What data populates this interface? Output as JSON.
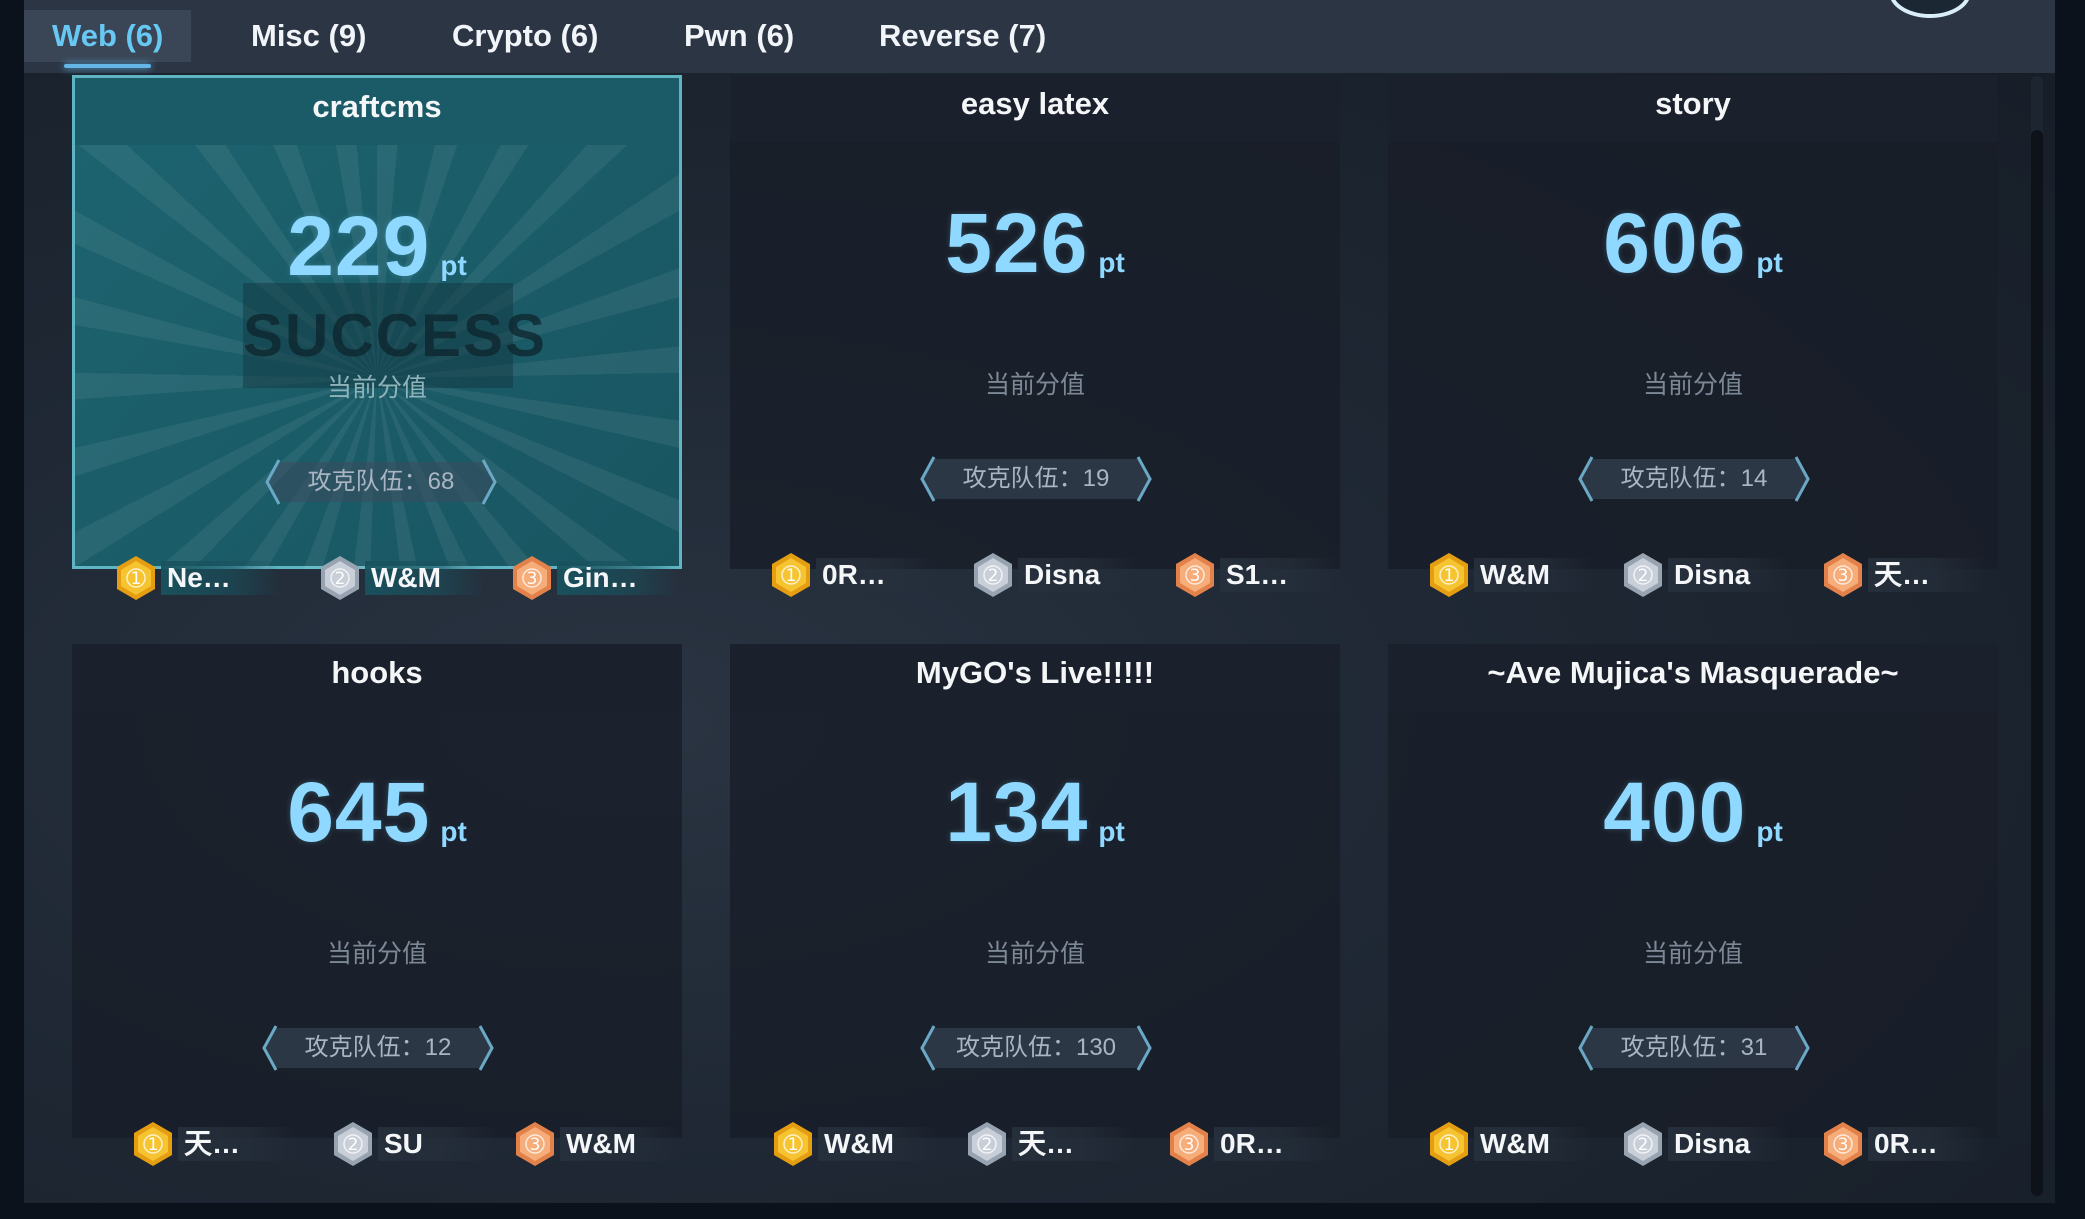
{
  "tabs": [
    {
      "label": "Web (6)"
    },
    {
      "label": "Misc (9)"
    },
    {
      "label": "Crypto (6)"
    },
    {
      "label": "Pwn (6)"
    },
    {
      "label": "Reverse (7)"
    }
  ],
  "colors": {
    "accent": "#68c8f4",
    "score": "#8fd8ff",
    "gold": "#f4b51f",
    "silver": "#b6bfca",
    "bronze": "#f29a63",
    "solved_border": "#5fb5c4"
  },
  "score_caption": "当前分值",
  "score_unit": "pt",
  "teams_prefix": "攻克队伍：",
  "challenges": [
    {
      "name": "craftcms",
      "score": "229",
      "teams": "攻克队伍：68",
      "solved": true,
      "stamp": "SUCCESS",
      "ranks": [
        {
          "place": "1",
          "name": "Ne…"
        },
        {
          "place": "2",
          "name": "W&M"
        },
        {
          "place": "3",
          "name": "Gin…"
        }
      ]
    },
    {
      "name": "easy latex",
      "score": "526",
      "teams": "攻克队伍：19",
      "solved": false,
      "ranks": [
        {
          "place": "1",
          "name": "0R…"
        },
        {
          "place": "2",
          "name": "Disna"
        },
        {
          "place": "3",
          "name": "S1…"
        }
      ]
    },
    {
      "name": "story",
      "score": "606",
      "teams": "攻克队伍：14",
      "solved": false,
      "ranks": [
        {
          "place": "1",
          "name": "W&M"
        },
        {
          "place": "2",
          "name": "Disna"
        },
        {
          "place": "3",
          "name": "天…"
        }
      ]
    },
    {
      "name": "hooks",
      "score": "645",
      "teams": "攻克队伍：12",
      "solved": false,
      "ranks": [
        {
          "place": "1",
          "name": "天…"
        },
        {
          "place": "2",
          "name": "SU"
        },
        {
          "place": "3",
          "name": "W&M"
        }
      ]
    },
    {
      "name": "MyGO's Live!!!!!",
      "score": "134",
      "teams": "攻克队伍：130",
      "solved": false,
      "ranks": [
        {
          "place": "1",
          "name": "W&M"
        },
        {
          "place": "2",
          "name": "天…"
        },
        {
          "place": "3",
          "name": "0R…"
        }
      ]
    },
    {
      "name": "~Ave Mujica's Masquerade~",
      "score": "400",
      "teams": "攻克队伍：31",
      "solved": false,
      "ranks": [
        {
          "place": "1",
          "name": "W&M"
        },
        {
          "place": "2",
          "name": "Disna"
        },
        {
          "place": "3",
          "name": "0R…"
        }
      ]
    }
  ]
}
